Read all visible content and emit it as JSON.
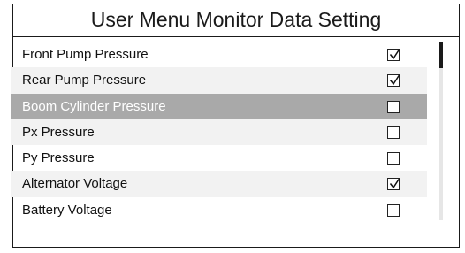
{
  "title": "User Menu Monitor Data Setting",
  "items": [
    {
      "label": "Front Pump Pressure",
      "checked": true
    },
    {
      "label": "Rear Pump Pressure",
      "checked": true
    },
    {
      "label": "Boom Cylinder Pressure",
      "checked": false
    },
    {
      "label": "Px Pressure",
      "checked": false
    },
    {
      "label": "Py Pressure",
      "checked": false
    },
    {
      "label": "Alternator Voltage",
      "checked": true
    },
    {
      "label": "Battery Voltage",
      "checked": false
    }
  ],
  "selected_index": 2,
  "colors": {
    "selected_row": "#a9a9a9",
    "alt_row": "#f2f2f2",
    "text": "#111111"
  }
}
